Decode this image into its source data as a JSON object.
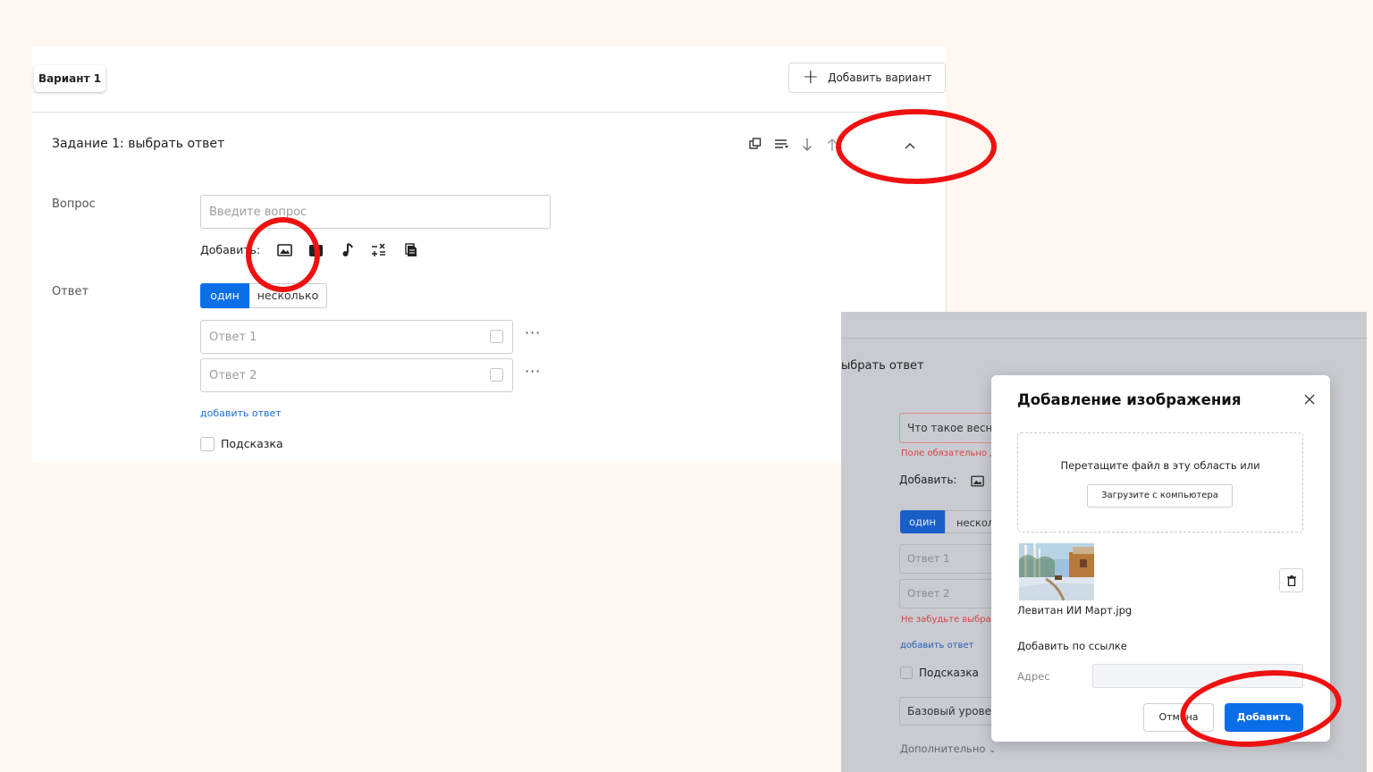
{
  "editor": {
    "variant_tab": "Вариант 1",
    "add_variant_label": "Добавить вариант",
    "task_title": "Задание 1: выбрать ответ",
    "question_label": "Вопрос",
    "question_placeholder": "Введите вопрос",
    "add_label": "Добавить:",
    "answer_label": "Ответ",
    "mode_single": "один",
    "mode_multiple": "несколько",
    "answers": [
      "Ответ 1",
      "Ответ 2"
    ],
    "more_symbol": "···",
    "add_answer_link": "добавить ответ",
    "hint_label": "Подсказка"
  },
  "background_form": {
    "task_title_partial": "ыбрать ответ",
    "question_value": "Что такое весна",
    "required_error": "Поле обязательно д",
    "add_label": "Добавить:",
    "mode_single": "один",
    "mode_multiple_partial": "нескол",
    "answers": [
      "Ответ 1",
      "Ответ 2"
    ],
    "answer_error": "Не забудьте выбрат",
    "add_answer_link": "добавить ответ",
    "hint_label": "Подсказка",
    "level_value": "Базовый уровен",
    "additional": "Дополнительно"
  },
  "modal": {
    "title": "Добавление изображения",
    "drop_text": "Перетащите файл в эту область или",
    "upload_button": "Загрузите с компьютера",
    "file_name": "Левитан ИИ Март.jpg",
    "by_link_title": "Добавить по ссылке",
    "address_label": "Адрес",
    "address_value": "",
    "cancel_label": "Отмена",
    "add_label": "Добавить"
  },
  "colors": {
    "accent": "#0a6ee8",
    "highlight_ring": "#ee1111",
    "error": "#d64545",
    "page_background": "#fff7f0",
    "overlay": "#c9cbd1"
  }
}
